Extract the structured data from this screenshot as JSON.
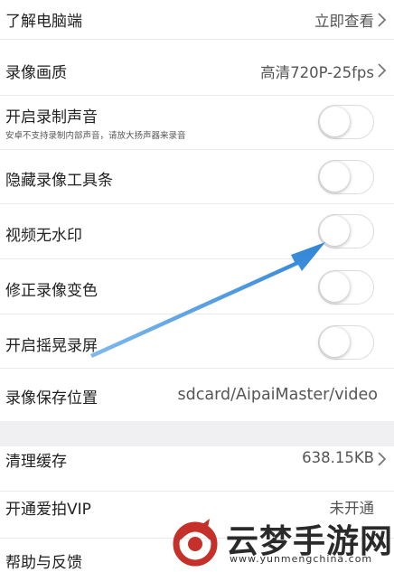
{
  "settings": {
    "pc": {
      "label": "了解电脑端",
      "value": "立即查看"
    },
    "quality": {
      "label": "录像画质",
      "value": "高清720P-25fps"
    },
    "record_audio": {
      "label": "开启录制声音",
      "note": "安卓不支持录制内部声音，请放大扬声器来录音",
      "on": false
    },
    "hide_toolbar": {
      "label": "隐藏录像工具条",
      "on": false
    },
    "no_watermark": {
      "label": "视频无水印",
      "on": false
    },
    "fix_color": {
      "label": "修正录像变色",
      "on": false
    },
    "shake_record": {
      "label": "开启摇晃录屏",
      "on": false
    },
    "save_location": {
      "label": "录像保存位置",
      "value": "sdcard/AipaiMaster/video"
    },
    "clear_cache": {
      "label": "清理缓存",
      "value": "638.15KB"
    },
    "vip": {
      "label": "开通爱拍VIP",
      "value": "未开通"
    },
    "help": {
      "label": "帮助与反馈"
    }
  },
  "watermark": {
    "title": "云梦手游网",
    "url": "www.yunmengchina.com"
  },
  "colors": {
    "arrow": "#3a8fdb",
    "divider": "#e9e9e9",
    "section_gap": "#f0f0f2"
  }
}
